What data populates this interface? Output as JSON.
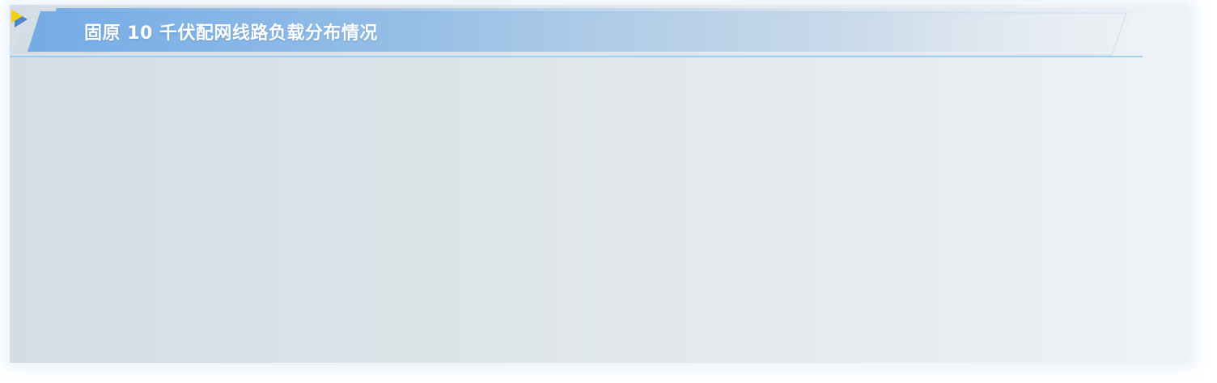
{
  "panel": {
    "title": "固原 10 千伏配网线路负载分布情况",
    "title_icon": "play-triangle-icon"
  },
  "colors": {
    "header_blue": "#5b9fe0",
    "accent_yellow": "#f5d20f",
    "panel_bg": "#dce4e9"
  }
}
